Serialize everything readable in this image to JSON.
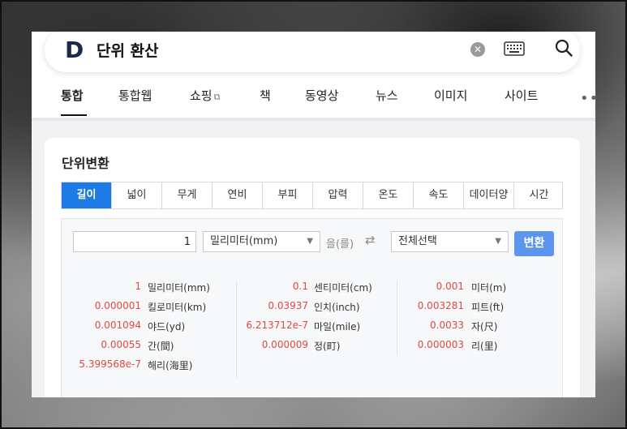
{
  "search": {
    "logo_letter": "D",
    "query": "단위 환산"
  },
  "tabs": [
    "통합",
    "통합웹",
    "쇼핑",
    "책",
    "동영상",
    "뉴스",
    "이미지",
    "사이트"
  ],
  "card": {
    "title": "단위변환",
    "unit_tabs": [
      "길이",
      "넓이",
      "무게",
      "연비",
      "부피",
      "압력",
      "온도",
      "속도",
      "데이터양",
      "시간"
    ],
    "active_unit_tab": "길이"
  },
  "converter": {
    "input_value": "1",
    "from_unit": "밀리미터(mm)",
    "particle": "을(를)",
    "to_unit": "전체선택",
    "convert_label": "변환"
  },
  "results": {
    "col1": [
      {
        "value": "1",
        "unit": "밀리미터(mm)"
      },
      {
        "value": "0.000001",
        "unit": "킬로미터(km)"
      },
      {
        "value": "0.001094",
        "unit": "야드(yd)"
      },
      {
        "value": "0.00055",
        "unit": "간(間)"
      },
      {
        "value": "5.399568e-7",
        "unit": "해리(海里)"
      }
    ],
    "col2": [
      {
        "value": "0.1",
        "unit": "센티미터(cm)"
      },
      {
        "value": "0.03937",
        "unit": "인치(inch)"
      },
      {
        "value": "6.213712e-7",
        "unit": "마일(mile)"
      },
      {
        "value": "0.000009",
        "unit": "정(町)"
      }
    ],
    "col3": [
      {
        "value": "0.001",
        "unit": "미터(m)"
      },
      {
        "value": "0.003281",
        "unit": "피트(ft)"
      },
      {
        "value": "0.0033",
        "unit": "자(尺)"
      },
      {
        "value": "0.000003",
        "unit": "리(里)"
      }
    ]
  },
  "colors": {
    "accent": "#1e7ae6",
    "button": "#5d95ee",
    "value_red": "#e3483e"
  },
  "icons": [
    "clear-icon",
    "keyboard-icon",
    "search-icon",
    "external-icon",
    "swap-icon",
    "more-icon"
  ]
}
